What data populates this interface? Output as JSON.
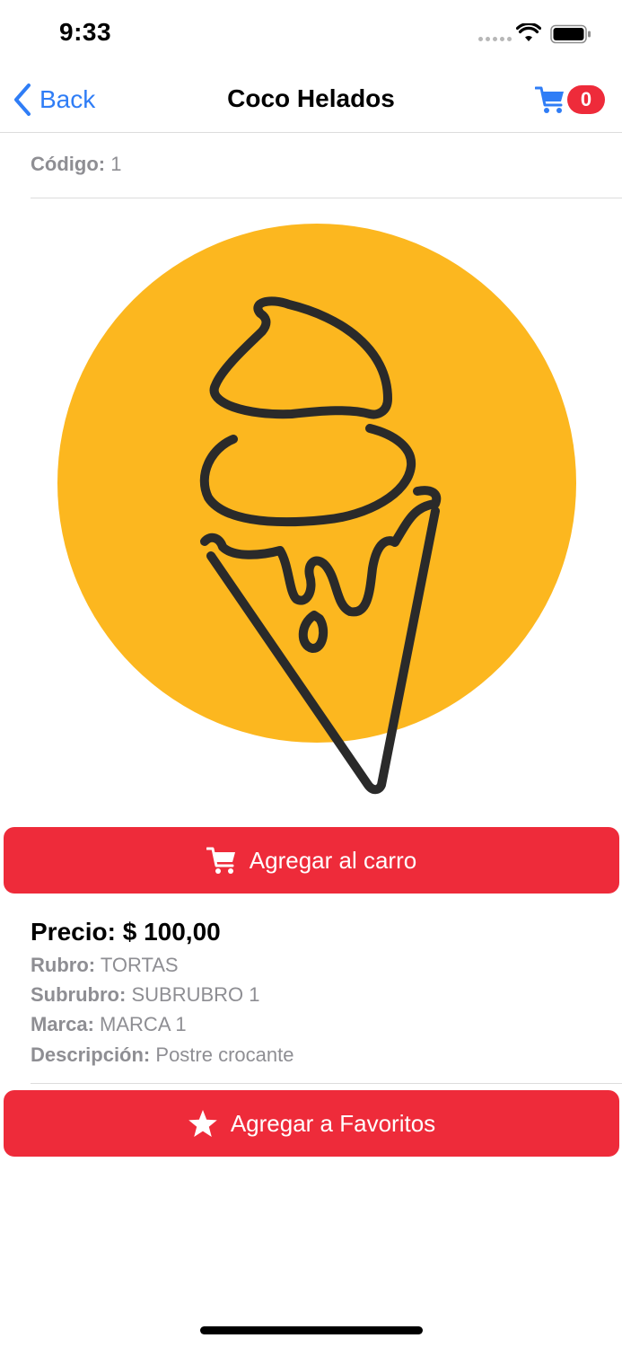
{
  "status_bar": {
    "time": "9:33"
  },
  "nav": {
    "back_label": "Back",
    "title": "Coco Helados",
    "cart_count": "0"
  },
  "product": {
    "code_label": "Código:",
    "code_value": "1",
    "price_label": "Precio:",
    "price_value": "$ 100,00",
    "details": [
      {
        "label": "Rubro:",
        "value": "TORTAS"
      },
      {
        "label": "Subrubro:",
        "value": "SUBRUBRO 1"
      },
      {
        "label": "Marca:",
        "value": "MARCA 1"
      },
      {
        "label": "Descripción:",
        "value": "Postre crocante"
      }
    ]
  },
  "actions": {
    "add_to_cart": "Agregar al carro",
    "add_to_favorites": "Agregar a Favoritos"
  },
  "colors": {
    "accent_blue": "#2f7df6",
    "button_red": "#ee2b3a",
    "image_circle": "#fcb71f"
  }
}
